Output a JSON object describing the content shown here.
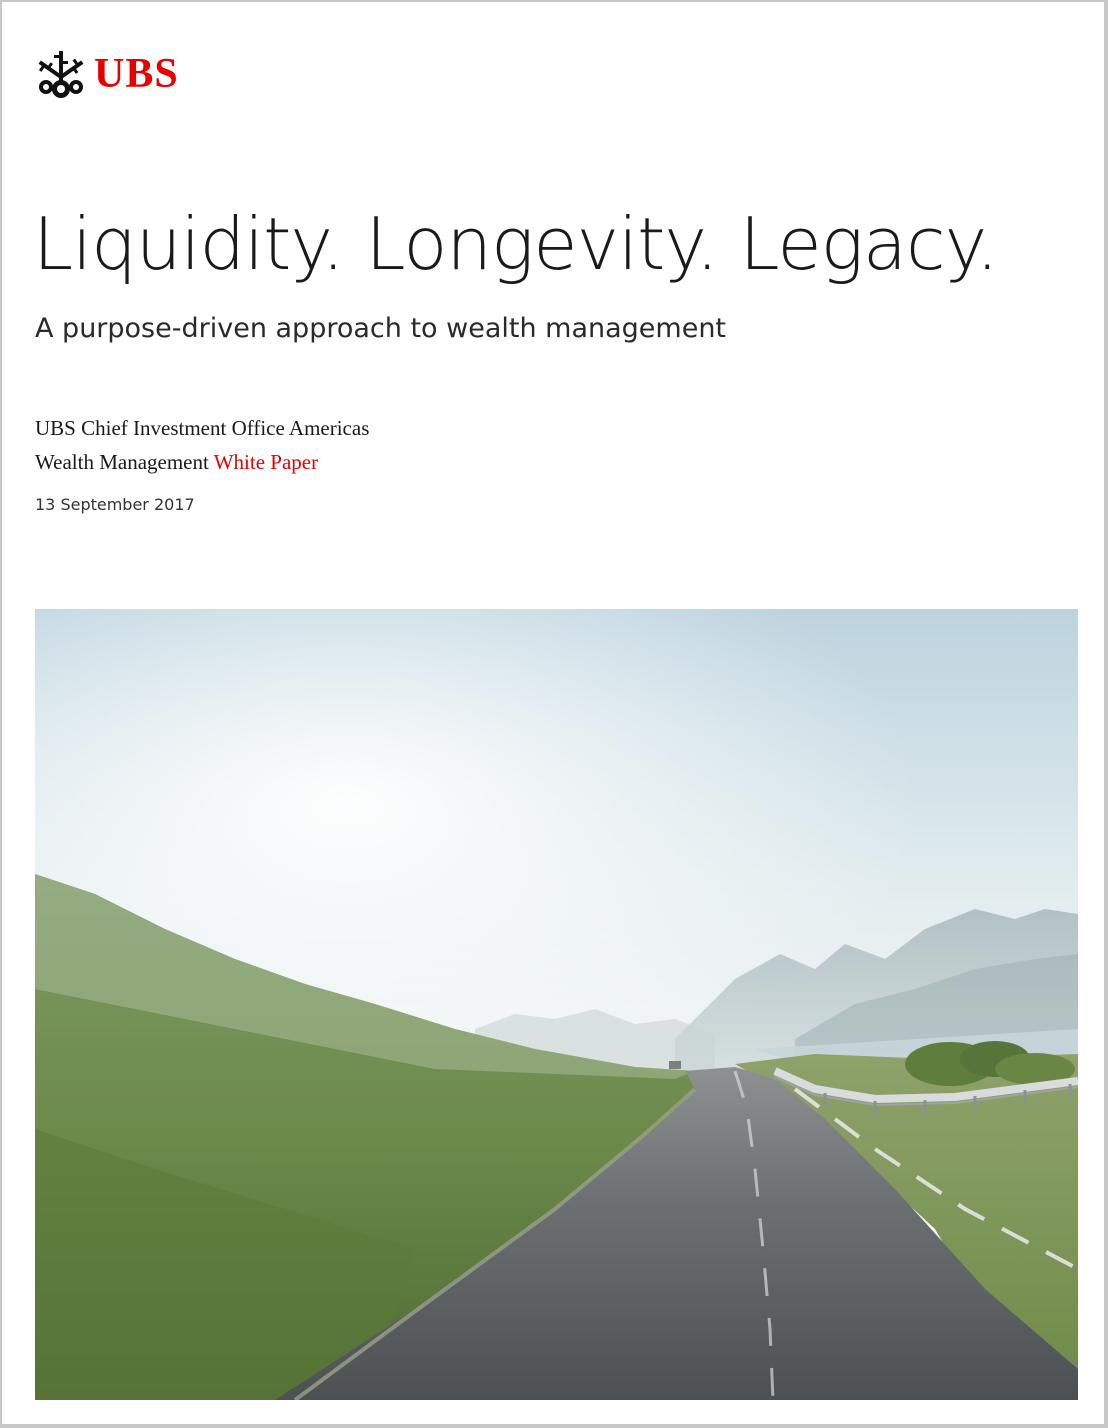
{
  "logo": {
    "text": "UBS",
    "icon": "three-keys-icon",
    "color": "#e60000"
  },
  "title": "Liquidity. Longevity. Legacy.",
  "subtitle": "A purpose-driven approach to wealth management",
  "publisher": "UBS Chief Investment Office Americas",
  "series": {
    "prefix": "Wealth Management",
    "highlight": "White Paper",
    "highlight_color": "#e60000"
  },
  "date": "13 September 2017",
  "cover_image": {
    "subject": "road-through-misty-mountain-landscape"
  }
}
